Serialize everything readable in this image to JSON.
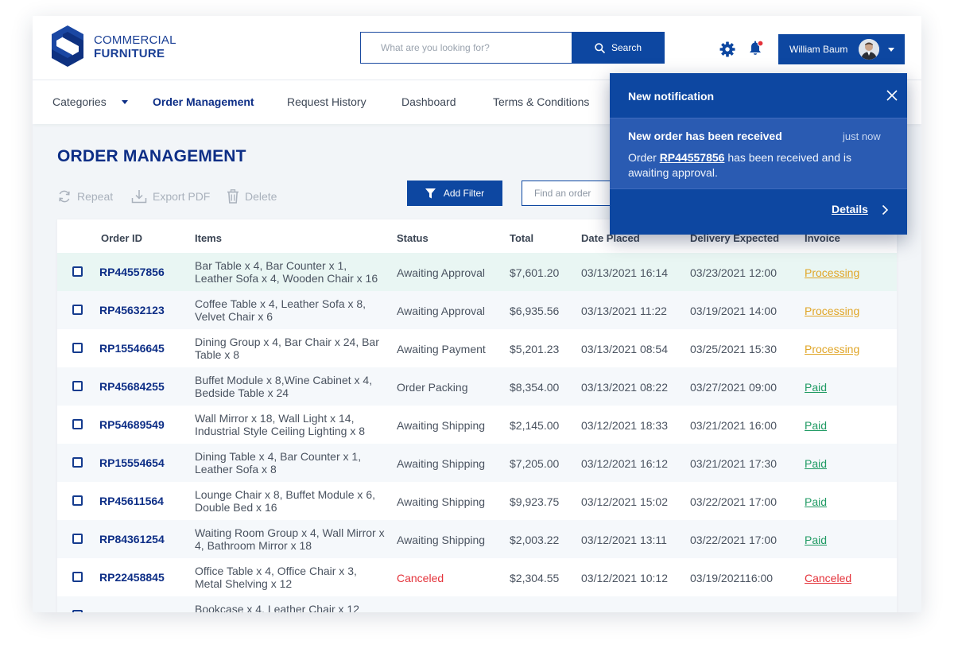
{
  "brand": {
    "line1": "COMMERCIAL",
    "line2": "FURNITURE"
  },
  "search": {
    "placeholder": "What are you looking for?",
    "button_label": "Search"
  },
  "user": {
    "name": "William Baum"
  },
  "nav": {
    "items": [
      {
        "label": "Categories",
        "active": false
      },
      {
        "label": "Order Management",
        "active": true
      },
      {
        "label": "Request History",
        "active": false
      },
      {
        "label": "Dashboard",
        "active": false
      },
      {
        "label": "Terms & Conditions",
        "active": false
      }
    ]
  },
  "page": {
    "title": "ORDER MANAGEMENT"
  },
  "actions": {
    "repeat": "Repeat",
    "export_pdf": "Export PDF",
    "delete": "Delete"
  },
  "filter": {
    "add_filter_label": "Add Filter",
    "find_placeholder": "Find an order"
  },
  "table": {
    "columns": [
      "Order ID",
      "Items",
      "Status",
      "Total",
      "Date Placed",
      "Delivery Expected",
      "Invoice"
    ],
    "rows": [
      {
        "id": "RP44557856",
        "items": "Bar Table x 4, Bar Counter x 1, Leather Sofa x 4, Wooden Chair x 16",
        "status": "Awaiting Approval",
        "total": "$7,601.20",
        "placed": "03/13/2021 16:14",
        "expected": "03/23/2021 12:00",
        "invoice": "Processing",
        "invoice_state": "processing"
      },
      {
        "id": "RP45632123",
        "items": "Coffee Table x 4, Leather Sofa x 8, Velvet Chair x 6",
        "status": "Awaiting Approval",
        "total": "$6,935.56",
        "placed": "03/13/2021 11:22",
        "expected": "03/19/2021 14:00",
        "invoice": "Processing",
        "invoice_state": "processing"
      },
      {
        "id": "RP15546645",
        "items": "Dining Group x 4, Bar Chair x 24, Bar Table x 8",
        "status": "Awaiting Payment",
        "total": "$5,201.23",
        "placed": "03/13/2021 08:54",
        "expected": "03/25/2021 15:30",
        "invoice": "Processing",
        "invoice_state": "processing"
      },
      {
        "id": "RP45684255",
        "items": "Buffet Module x 8,Wine Cabinet x 4, Bedside Table x 24",
        "status": "Order Packing",
        "total": "$8,354.00",
        "placed": "03/13/2021 08:22",
        "expected": "03/27/2021 09:00",
        "invoice": "Paid",
        "invoice_state": "paid"
      },
      {
        "id": "RP54689549",
        "items": "Wall Mirror x 18, Wall Light x 14, Industrial Style Ceiling Lighting x 8",
        "status": "Awaiting Shipping",
        "total": "$2,145.00",
        "placed": "03/12/2021 18:33",
        "expected": "03/21/2021 16:00",
        "invoice": "Paid",
        "invoice_state": "paid"
      },
      {
        "id": "RP15554654",
        "items": "Dining Table x 4, Bar Counter x 1, Leather Sofa x 8",
        "status": "Awaiting Shipping",
        "total": "$7,205.00",
        "placed": "03/12/2021 16:12",
        "expected": "03/21/2021 17:30",
        "invoice": "Paid",
        "invoice_state": "paid"
      },
      {
        "id": "RP45611564",
        "items": "Lounge Chair x 8, Buffet Module x 6, Double Bed x 16",
        "status": "Awaiting Shipping",
        "total": "$9,923.75",
        "placed": "03/12/2021 15:02",
        "expected": "03/22/2021 17:00",
        "invoice": "Paid",
        "invoice_state": "paid"
      },
      {
        "id": "RP84361254",
        "items": "Waiting Room Group x 4, Wall Mirror x 4, Bathroom Mirror x 18",
        "status": "Awaiting Shipping",
        "total": "$2,003.22",
        "placed": "03/12/2021 13:11",
        "expected": "03/22/2021 17:00",
        "invoice": "Paid",
        "invoice_state": "paid"
      },
      {
        "id": "RP22458845",
        "items": "Office Table x 4, Office Chair x 3, Metal Shelving x 12",
        "status": "Canceled",
        "total": "$2,304.55",
        "placed": "03/12/2021 10:12",
        "expected": "03/19/202116:00",
        "invoice": "Canceled",
        "invoice_state": "canceled"
      },
      {
        "id": "",
        "items": "Bookcase x 4, Leather Chair x 12",
        "status": "",
        "total": "",
        "placed": "",
        "expected": "",
        "invoice": "",
        "invoice_state": "paid"
      }
    ]
  },
  "notification": {
    "header": "New notification",
    "title": "New order has been received",
    "time": "just now",
    "msg_prefix": "Order ",
    "order_id": "RP44557856",
    "msg_suffix": " has been received and is awaiting approval.",
    "details_label": "Details"
  },
  "colors": {
    "primary": "#0d47a1",
    "navy": "#0d2e86",
    "processing": "#e0a526",
    "paid": "#1f9a63",
    "canceled": "#e4323a",
    "highlight_row": "#e9f6f3"
  }
}
